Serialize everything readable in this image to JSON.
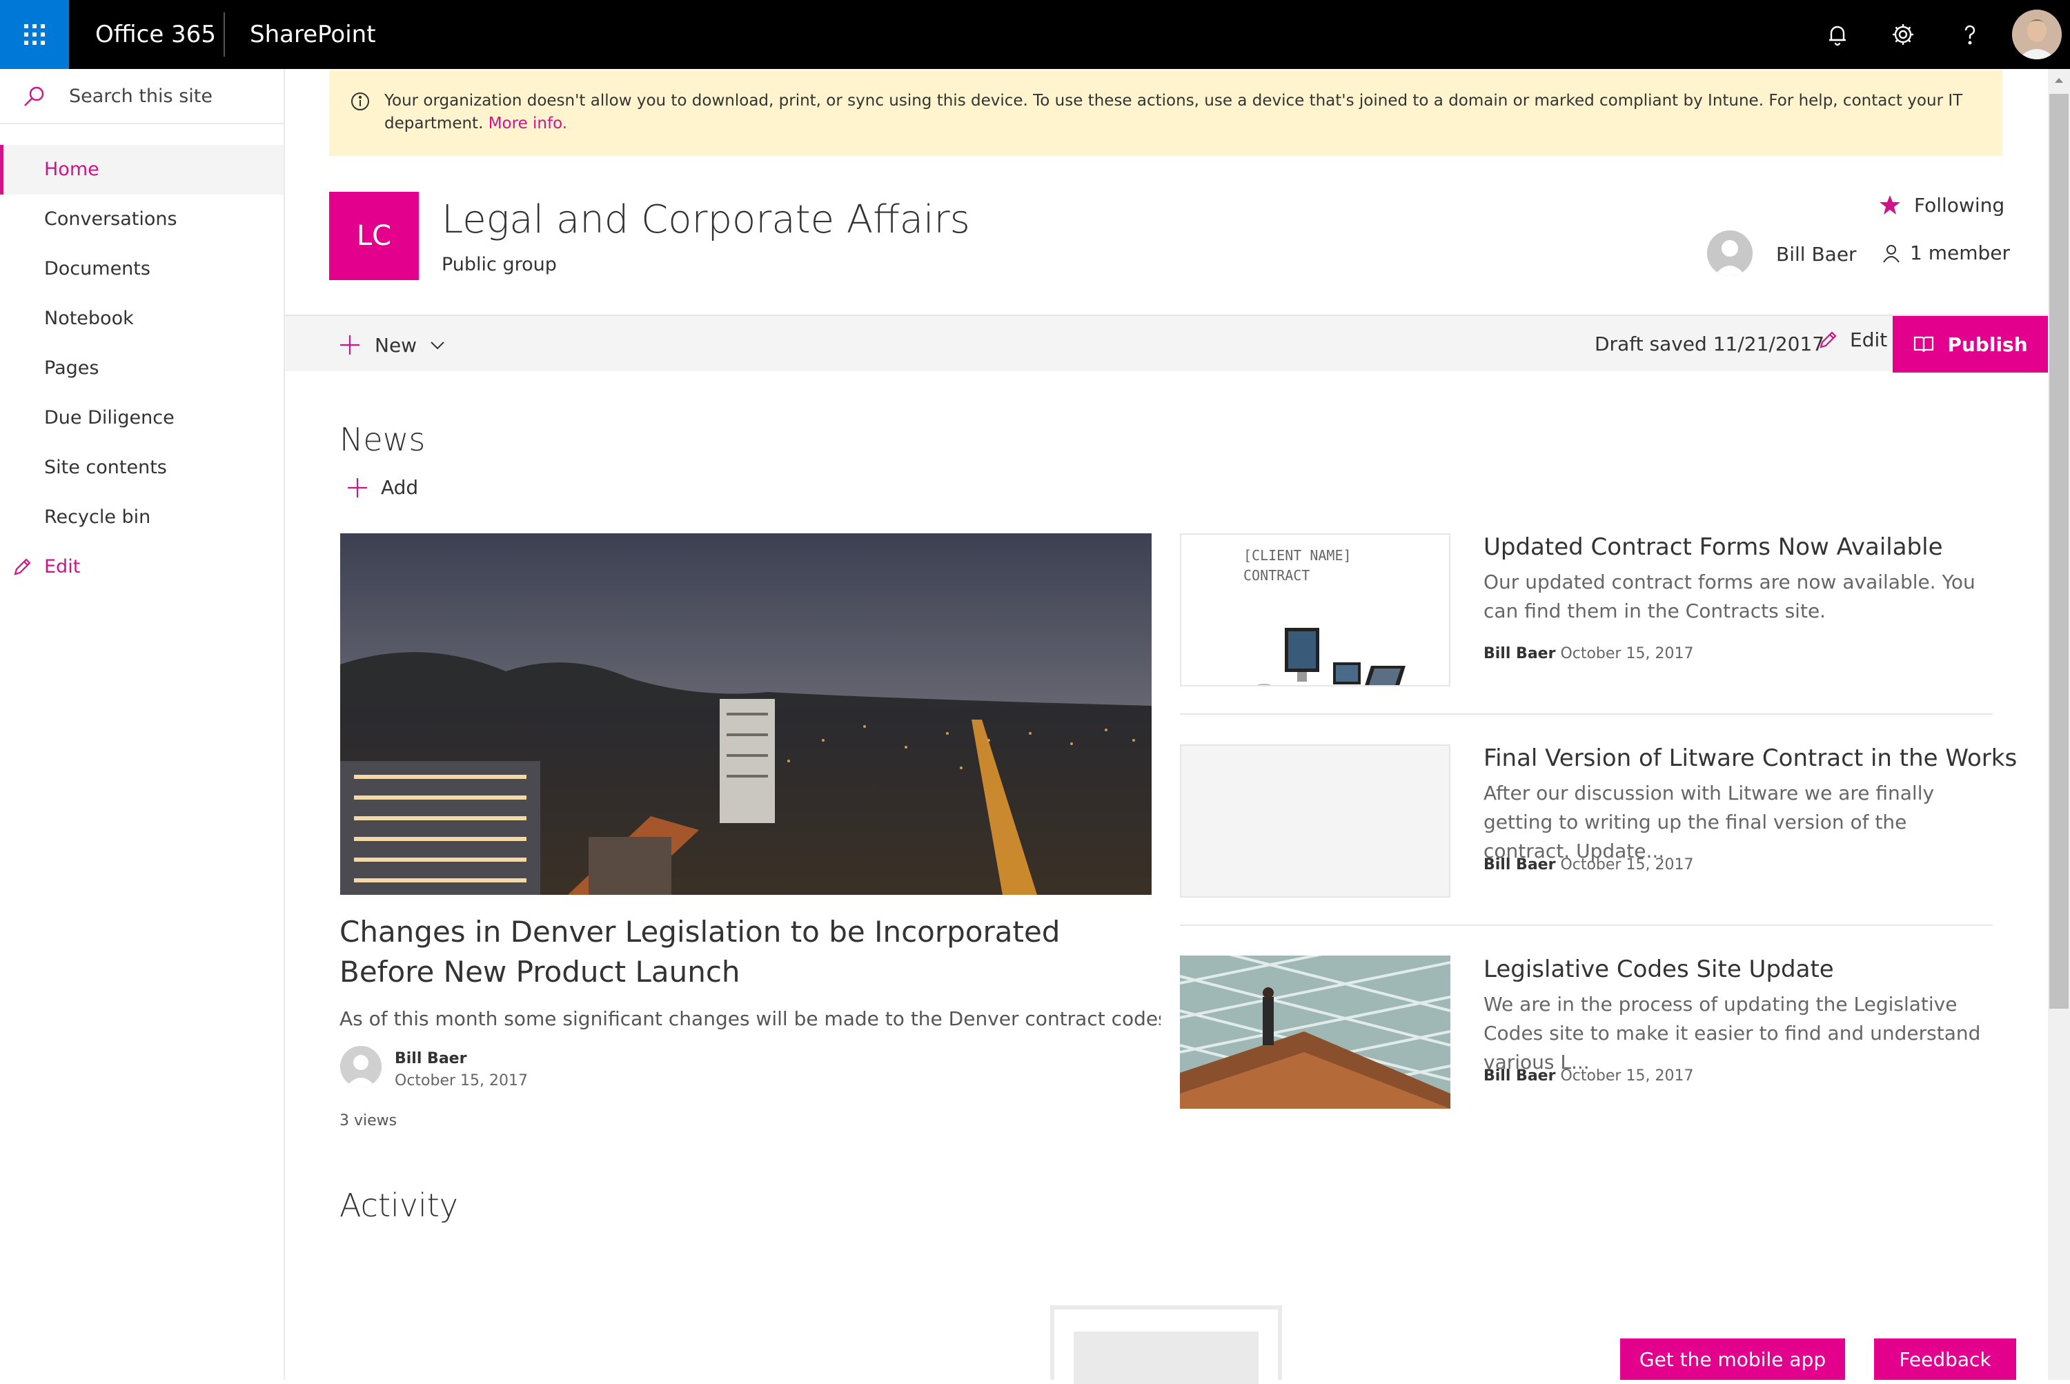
{
  "suite": {
    "app_name": "Office 365",
    "product": "SharePoint"
  },
  "nav": {
    "search_placeholder": "Search this site",
    "items": [
      {
        "label": "Home",
        "active": true
      },
      {
        "label": "Conversations"
      },
      {
        "label": "Documents"
      },
      {
        "label": "Notebook"
      },
      {
        "label": "Pages"
      },
      {
        "label": "Due Diligence"
      },
      {
        "label": "Site contents"
      },
      {
        "label": "Recycle bin"
      }
    ],
    "edit_label": "Edit"
  },
  "banner": {
    "message": "Your organization doesn't allow you to download, print, or sync using this device. To use these actions, use a device that's joined to a domain or marked compliant by Intune. For help, contact your IT department.",
    "link": "More info."
  },
  "site": {
    "logo_initials": "LC",
    "title": "Legal and Corporate Affairs",
    "subtitle": "Public group",
    "following_label": "Following",
    "owner_name": "Bill Baer",
    "members_label": "1 member"
  },
  "commandbar": {
    "new_label": "New",
    "draft_status": "Draft saved 11/21/2017",
    "edit_label": "Edit",
    "publish_label": "Publish"
  },
  "news": {
    "title": "News",
    "add_label": "Add",
    "hero": {
      "title": "Changes in Denver Legislation to be Incorporated Before New Product Launch",
      "description": "As of this month some significant changes will be made to the Denver contract codes....",
      "author": "Bill Baer",
      "date": "October 15, 2017",
      "views": "3 views"
    },
    "items": [
      {
        "title": "Updated Contract Forms Now Available",
        "description": "Our updated contract forms are now available. You can find them in the Contracts site.",
        "author": "Bill Baer",
        "date": "October 15, 2017",
        "thumb_text_1": "[CLIENT NAME]",
        "thumb_text_2": "CONTRACT"
      },
      {
        "title": "Final Version of Litware Contract in the Works",
        "description": "After our discussion with Litware we are finally getting to writing up the final version of the contract. Update...",
        "author": "Bill Baer",
        "date": "October 15, 2017"
      },
      {
        "title": "Legislative Codes Site Update",
        "description": "We are in the process of updating the Legislative Codes site to make it easier to find and understand various L...",
        "author": "Bill Baer",
        "date": "October 15, 2017"
      }
    ]
  },
  "activity": {
    "title": "Activity"
  },
  "footer": {
    "mobile_label": "Get the mobile app",
    "feedback_label": "Feedback"
  },
  "colors": {
    "accent": "#e3008c",
    "waffle": "#0078d7",
    "banner": "#fff4ce"
  }
}
